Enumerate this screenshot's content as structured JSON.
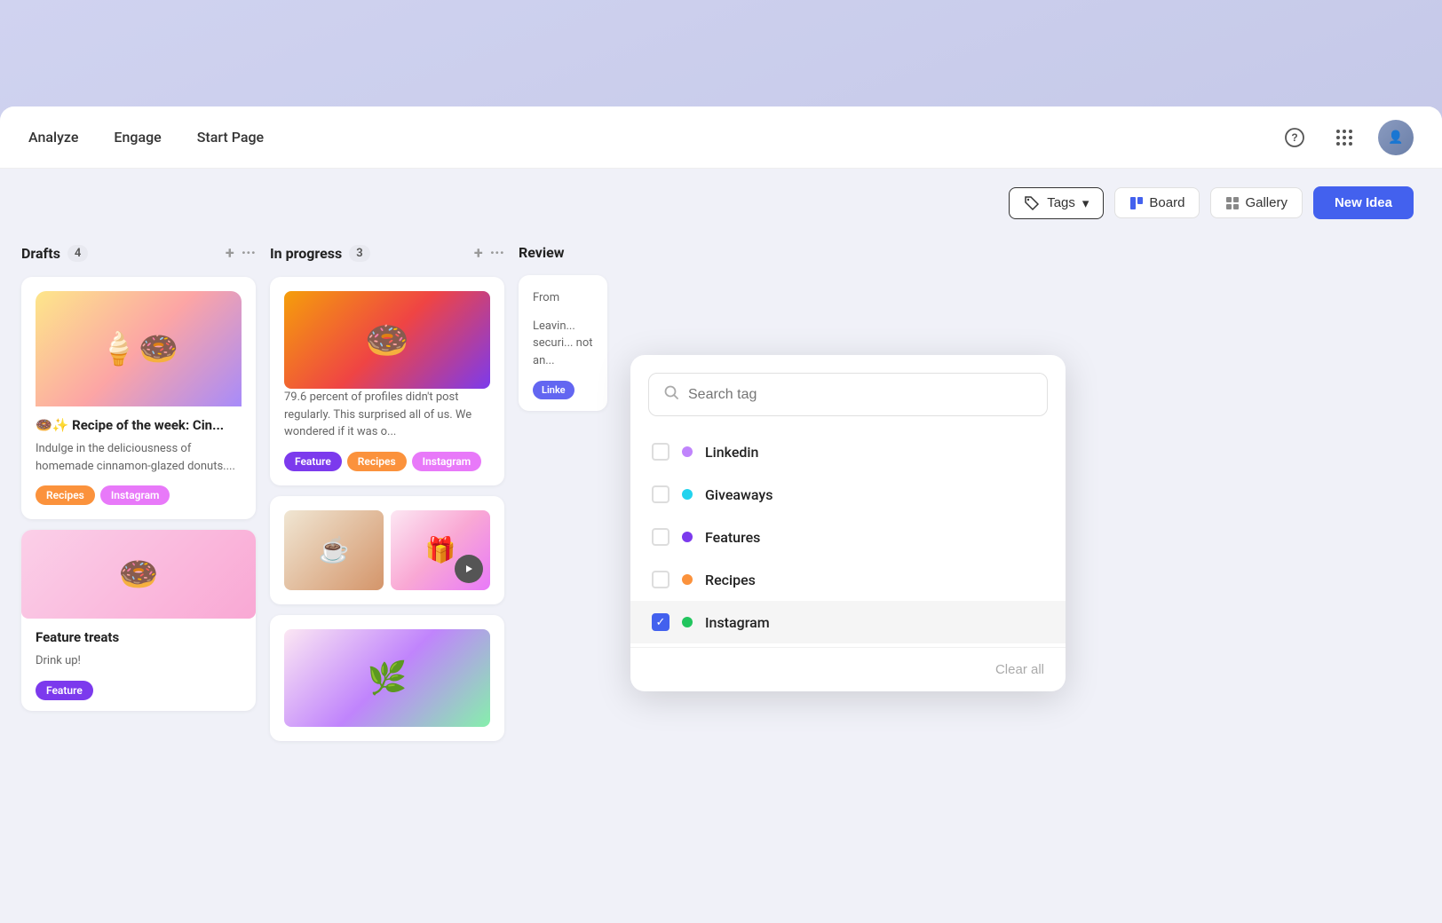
{
  "background": {
    "color": "#c5c8e8"
  },
  "nav": {
    "items": [
      {
        "label": "Analyze",
        "active": false
      },
      {
        "label": "Engage",
        "active": false
      },
      {
        "label": "Start Page",
        "active": false
      }
    ]
  },
  "toolbar": {
    "tags_label": "Tags",
    "board_label": "Board",
    "gallery_label": "Gallery",
    "new_idea_label": "New Idea"
  },
  "columns": [
    {
      "id": "drafts",
      "title": "Drafts",
      "count": "4",
      "cards": [
        {
          "title": "🍩✨ Recipe of the week: Cin...",
          "text": "Indulge in the deliciousness of homemade cinnamon-glazed donuts....",
          "tags": [
            "Recipes",
            "Instagram"
          ],
          "has_popsicle_image": true
        },
        {
          "title": "Feature treats",
          "text": "Drink up!",
          "tags": [
            "Feature"
          ],
          "has_pink_donut": true
        }
      ]
    },
    {
      "id": "in-progress",
      "title": "In progress",
      "count": "3",
      "cards": [
        {
          "text": "79.6 percent of profiles didn't post regularly. This surprised all of us. We wondered if it was o...",
          "tags": [
            "Feature",
            "Recipes",
            "Instagram"
          ],
          "has_donut_image": true
        },
        {
          "has_image_row": true,
          "has_lower_plant": true
        }
      ]
    },
    {
      "id": "review",
      "title": "Review",
      "partial": true,
      "cards": [
        {
          "title": "From...",
          "text": "Leaving... securi... not an...",
          "tags": [
            "Linkedin"
          ]
        }
      ]
    }
  ],
  "tag_dropdown": {
    "search_placeholder": "Search tag",
    "tags": [
      {
        "label": "Linkedin",
        "color": "#c084fc",
        "checked": false
      },
      {
        "label": "Giveaways",
        "color": "#22d3ee",
        "checked": false
      },
      {
        "label": "Features",
        "color": "#7c3aed",
        "checked": false
      },
      {
        "label": "Recipes",
        "color": "#fb923c",
        "checked": false
      },
      {
        "label": "Instagram",
        "color": "#22c55e",
        "checked": true
      }
    ],
    "clear_label": "Clear all"
  }
}
